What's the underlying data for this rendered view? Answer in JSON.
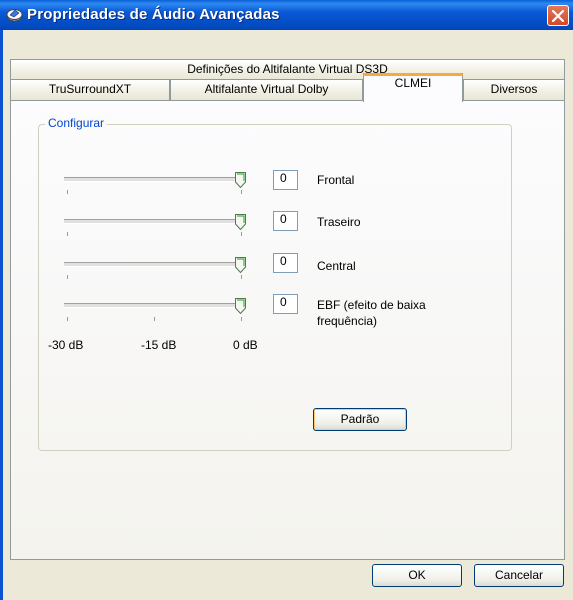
{
  "window": {
    "title": "Propriedades de Áudio Avançadas"
  },
  "tabs": {
    "row_back": [
      "Definições do Altifalante Virtual DS3D"
    ],
    "row_front": [
      "TruSurroundXT",
      "Altifalante Virtual Dolby",
      "CLMEI",
      "Diversos"
    ],
    "selected": "CLMEI"
  },
  "group": {
    "label": "Configurar"
  },
  "channels": [
    {
      "value": "0",
      "label": "Frontal",
      "level_db": 0
    },
    {
      "value": "0",
      "label": "Traseiro",
      "level_db": 0
    },
    {
      "value": "0",
      "label": "Central",
      "level_db": 0
    },
    {
      "value": "0",
      "label_line1": "EBF (efeito de baixa",
      "label_line2": "frequência)",
      "level_db": 0
    }
  ],
  "scale": {
    "min": "-30 dB",
    "mid": "-15 dB",
    "max": "0 dB"
  },
  "buttons": {
    "default": "Padrão",
    "ok": "OK",
    "cancel": "Cancelar"
  },
  "colors": {
    "titlebar": "#0550c8",
    "group_label": "#0046d5",
    "selected_tab_accent": "#f7a93c",
    "close": "#d2482a"
  }
}
